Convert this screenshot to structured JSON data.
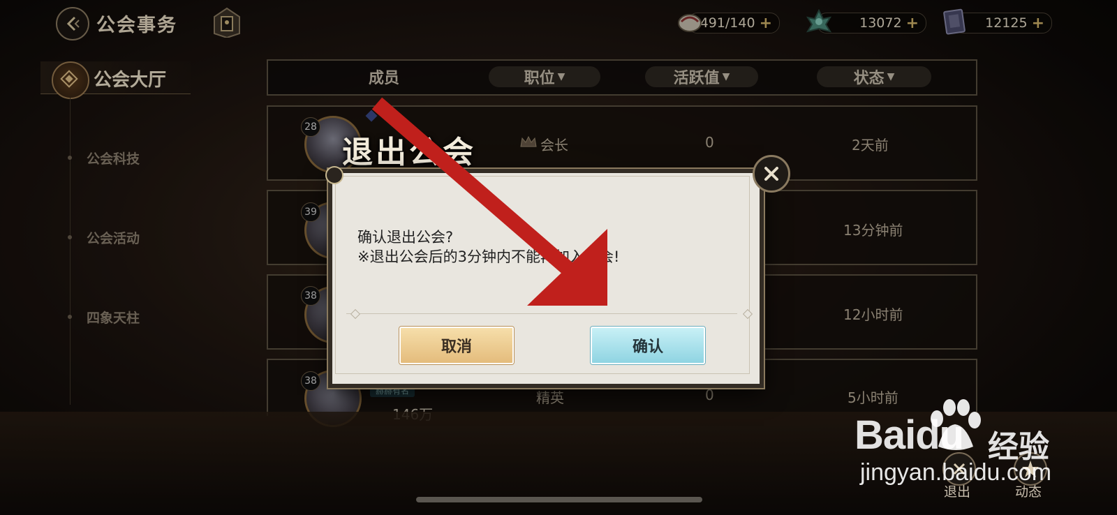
{
  "header": {
    "title": "公会事务"
  },
  "resources": [
    {
      "icon": "stamina-icon",
      "value": "1491/140"
    },
    {
      "icon": "jade-lotus-icon",
      "value": "13072"
    },
    {
      "icon": "book-icon",
      "value": "12125"
    }
  ],
  "sidebar": {
    "main": "公会大厅",
    "items": [
      {
        "label": "公会科技"
      },
      {
        "label": "公会活动"
      },
      {
        "label": "四象天柱"
      }
    ]
  },
  "table": {
    "headers": {
      "member": "成员",
      "position": "职位",
      "activity": "活跃值",
      "status": "状态"
    },
    "rows": [
      {
        "level": "28",
        "position": "会长",
        "activity": "0",
        "status": "2天前"
      },
      {
        "level": "39",
        "position": "",
        "activity": "",
        "status": "13分钟前"
      },
      {
        "level": "38",
        "position": "",
        "activity": "",
        "status": "12小时前"
      },
      {
        "level": "38",
        "title_badge": "赫赫有名",
        "power": "146万",
        "position": "精英",
        "activity": "0",
        "status": "5小时前"
      }
    ]
  },
  "modal": {
    "heading": "退出公会",
    "line1": "确认退出公会?",
    "line2": "※退出公会后的3分钟内不能再加入公会!",
    "cancel": "取消",
    "confirm": "确认"
  },
  "bottom": {
    "exit": "退出",
    "news": "动态"
  },
  "watermark": {
    "brand": "Baidu",
    "sub": "经验",
    "url": "jingyan.baidu.com"
  },
  "colors": {
    "annotation_arrow": "#c0201c",
    "confirm_button": "#8fd4e2",
    "cancel_button": "#e4bc7c"
  }
}
